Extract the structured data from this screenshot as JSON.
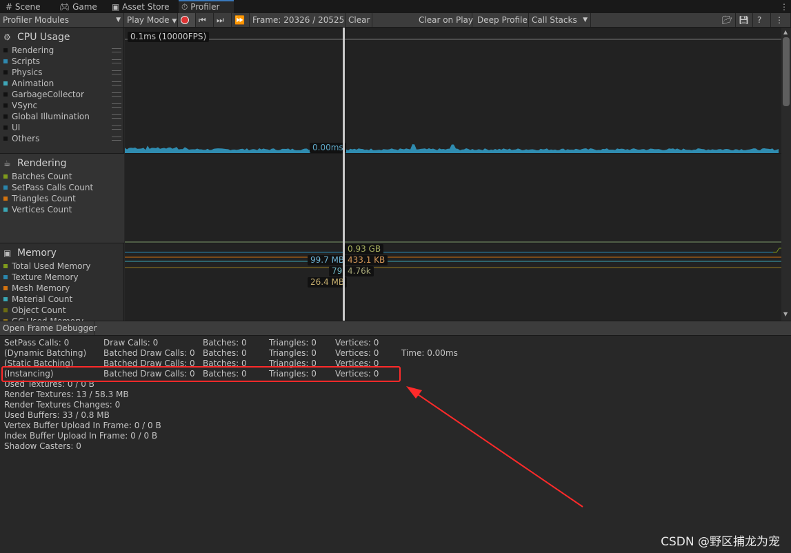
{
  "tabs": [
    {
      "label": "Scene",
      "icon": "grid-icon"
    },
    {
      "label": "Game",
      "icon": "gamepad-icon"
    },
    {
      "label": "Asset Store",
      "icon": "bag-icon"
    },
    {
      "label": "Profiler",
      "icon": "stopwatch-icon",
      "active": true
    }
  ],
  "toolbar": {
    "modules": "Profiler Modules",
    "play_mode": "Play Mode",
    "frame": "Frame: 20326 / 20525",
    "clear": "Clear",
    "clear_on_play": "Clear on Play",
    "deep_profile": "Deep Profile",
    "call_stacks": "Call Stacks"
  },
  "cpu": {
    "title": "CPU Usage",
    "items": [
      {
        "label": "Rendering",
        "color": "#111111"
      },
      {
        "label": "Scripts",
        "color": "#2f89b0"
      },
      {
        "label": "Physics",
        "color": "#111111"
      },
      {
        "label": "Animation",
        "color": "#3fa7b8"
      },
      {
        "label": "GarbageCollector",
        "color": "#111111"
      },
      {
        "label": "VSync",
        "color": "#111111"
      },
      {
        "label": "Global Illumination",
        "color": "#111111"
      },
      {
        "label": "UI",
        "color": "#111111"
      },
      {
        "label": "Others",
        "color": "#111111"
      }
    ],
    "scale_label": "0.1ms (10000FPS)",
    "cursor_value": "0.00ms"
  },
  "rendering": {
    "title": "Rendering",
    "items": [
      {
        "label": "Batches Count",
        "color": "#7e9a1c"
      },
      {
        "label": "SetPass Calls Count",
        "color": "#2a86ad"
      },
      {
        "label": "Triangles Count",
        "color": "#d4730f"
      },
      {
        "label": "Vertices Count",
        "color": "#3aa7b5"
      }
    ]
  },
  "memory": {
    "title": "Memory",
    "items": [
      {
        "label": "Total Used Memory",
        "color": "#7e9a1c"
      },
      {
        "label": "Texture Memory",
        "color": "#2a86ad"
      },
      {
        "label": "Mesh Memory",
        "color": "#d4730f"
      },
      {
        "label": "Material Count",
        "color": "#3aa7b5"
      },
      {
        "label": "Object Count",
        "color": "#6b6b12"
      },
      {
        "label": "GC Used Memory",
        "color": "#9a7c1c"
      }
    ],
    "values": {
      "total": "0.93 GB",
      "texture": "99.7 MB",
      "mesh": "433.1 KB",
      "material": "79",
      "object": "4.76k",
      "gc": "26.4 MB"
    }
  },
  "bottom": {
    "open_frame_debugger": "Open Frame Debugger"
  },
  "stats": {
    "row1": [
      "SetPass Calls: 0",
      "Draw Calls: 0",
      "Batches: 0",
      "Triangles: 0",
      "Vertices: 0"
    ],
    "row2": [
      "(Dynamic Batching)",
      "Batched Draw Calls: 0",
      "Batches: 0",
      "Triangles: 0",
      "Vertices: 0",
      "Time: 0.00ms"
    ],
    "row3": [
      "(Static Batching)",
      "Batched Draw Calls: 0",
      "Batches: 0",
      "Triangles: 0",
      "Vertices: 0"
    ],
    "row4": [
      "(Instancing)",
      "Batched Draw Calls: 0",
      "Batches: 0",
      "Triangles: 0",
      "Vertices: 0"
    ],
    "lines": [
      "Used Textures: 0 / 0 B",
      "Render Textures: 13 / 58.3 MB",
      "Render Textures Changes: 0",
      "Used Buffers: 33 / 0.8 MB",
      "Vertex Buffer Upload In Frame: 0 / 0 B",
      "Index Buffer Upload In Frame: 0 / 0 B",
      "Shadow Casters: 0"
    ]
  },
  "annotation_color": "#ff2a2a",
  "watermark": "CSDN @野区捕龙为宠"
}
